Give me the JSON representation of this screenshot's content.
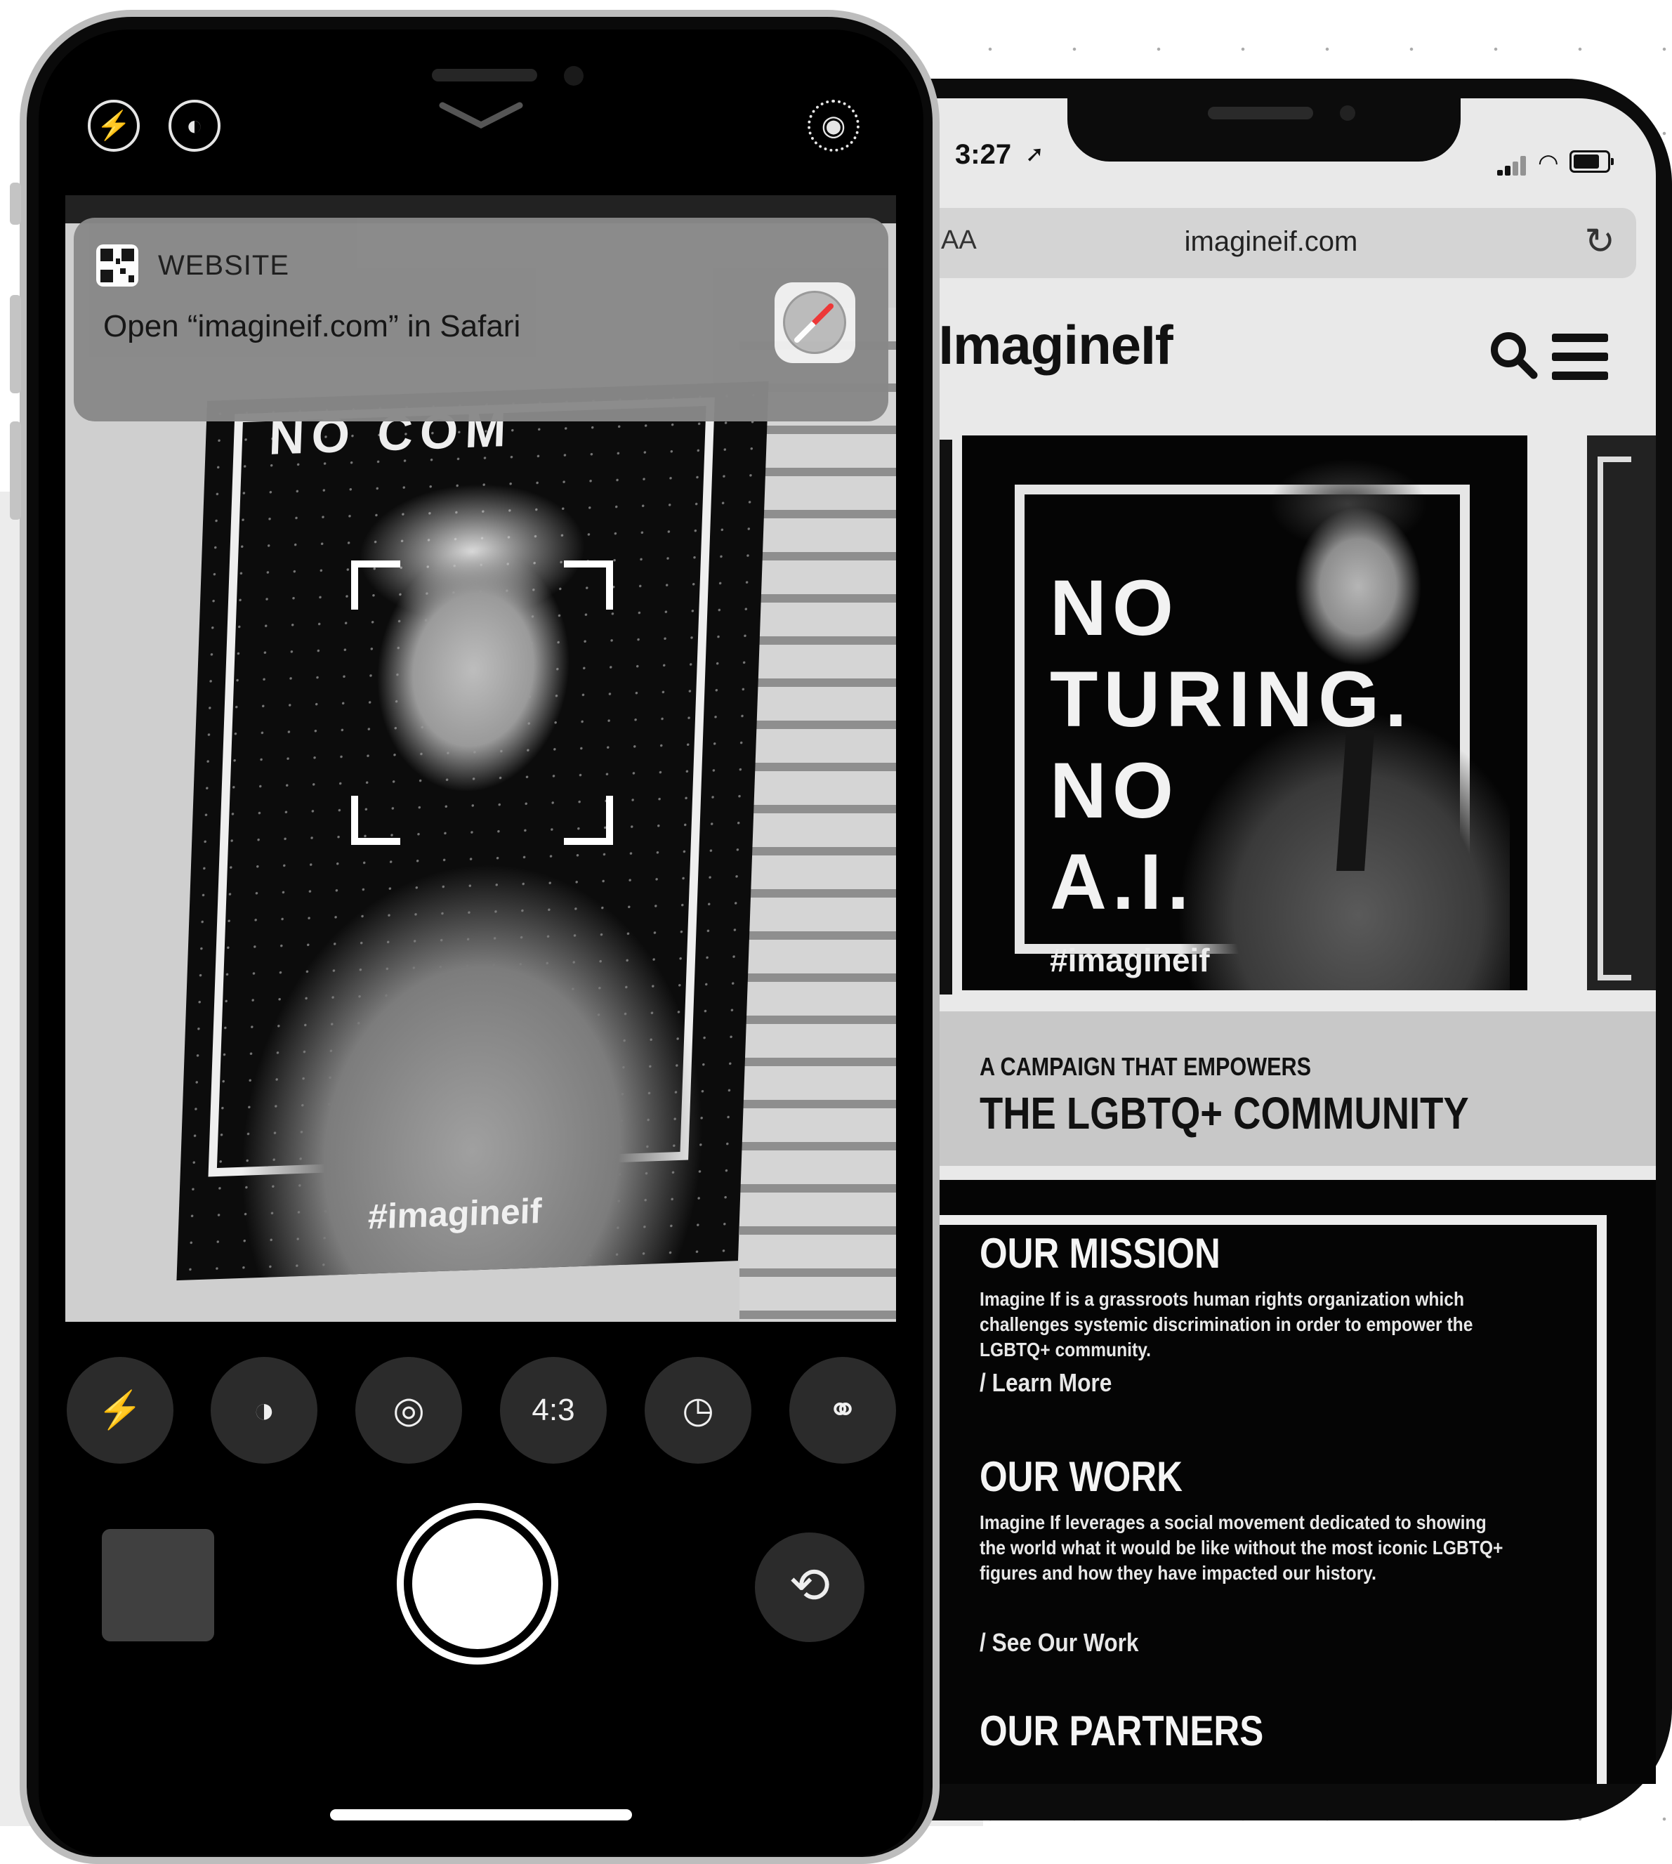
{
  "camera": {
    "top_icons": [
      "flash-off-icon",
      "live-photo-off-icon",
      "live-photo-icon"
    ],
    "qr_banner": {
      "kind_label": "WEBSITE",
      "message": "Open “imagineif.com” in Safari",
      "app_icon": "safari-icon"
    },
    "billboard": {
      "headline": "NO COM",
      "hashtag": "#imagineif"
    },
    "controls": {
      "flash": "flash-icon",
      "live": "live-photo-icon",
      "live2": "target-icon",
      "aspect_label": "4:3",
      "timer": "timer-icon",
      "filters": "filters-icon"
    }
  },
  "browser": {
    "status": {
      "time": "3:27"
    },
    "address_bar": {
      "text_size_label": "AA",
      "url": "imagineif.com"
    },
    "site": {
      "brand": "#ImagineIf",
      "hero": {
        "lines": [
          "NO",
          "TURING.",
          "NO",
          "A.I."
        ],
        "hashtag": "#imagineif"
      },
      "campaign": {
        "kicker": "A CAMPAIGN THAT EMPOWERS",
        "title": "THE LGBTQ+ COMMUNITY"
      },
      "mission": {
        "heading": "OUR MISSION",
        "body": "Imagine If is a grassroots human rights organization which challenges systemic discrimination in order to empower the LGBTQ+ community.",
        "link": "/ Learn More"
      },
      "work": {
        "heading": "OUR WORK",
        "body": "Imagine If leverages a social movement dedicated to showing the world what it would be like without the most iconic LGBTQ+ figures and how they have impacted our history.",
        "link": "/ See Our Work"
      },
      "partners": {
        "heading": "OUR PARTNERS"
      }
    }
  }
}
